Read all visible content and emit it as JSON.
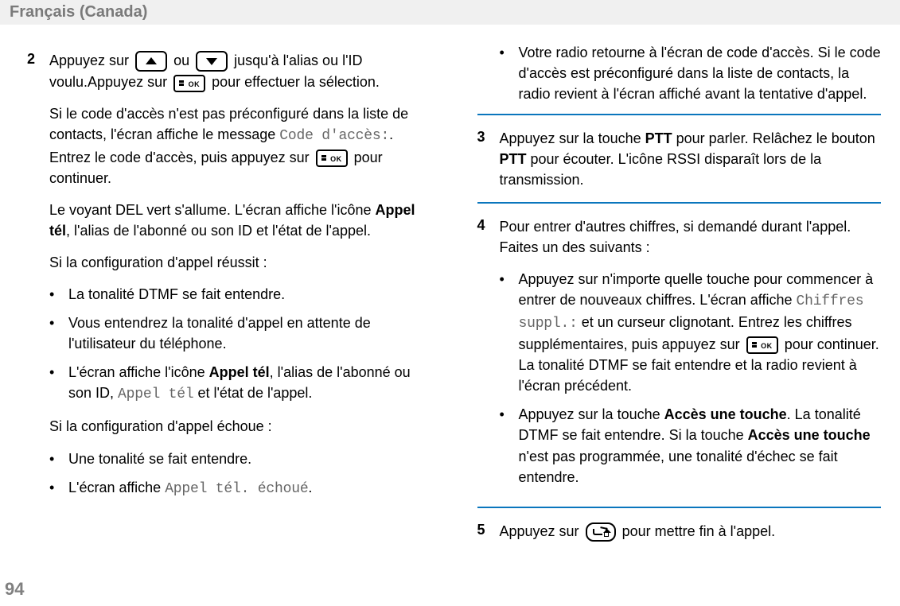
{
  "header": {
    "title": "Français (Canada)"
  },
  "pageNumber": "94",
  "left": {
    "step2": {
      "num": "2",
      "para1a": "Appuyez sur ",
      "para1b": " ou ",
      "para1c": " jusqu'à l'alias ou l'ID voulu.Appuyez sur ",
      "para1d": " pour effectuer la sélection.",
      "para2a": "Si le code d'accès n'est pas préconfiguré dans la liste de contacts, l'écran affiche le message ",
      "para2code": "Code d'accès:",
      "para2b": ". Entrez le code d'accès, puis appuyez sur ",
      "para2c": " pour continuer.",
      "para3a": "Le voyant DEL vert s'allume. L'écran affiche l'icône ",
      "para3bold": "Appel tél",
      "para3b": ", l'alias de l'abonné ou son ID et l'état de l'appel.",
      "para4": "Si la configuration d'appel réussit :",
      "success": [
        "La tonalité DTMF se fait entendre.",
        "Vous entendrez la tonalité d'appel en attente de l'utilisateur du téléphone."
      ],
      "success3a": "L'écran affiche l'icône ",
      "success3bold1": "Appel tél",
      "success3b": ", l'alias de l'abonné ou son ID, ",
      "success3code": "Appel tél",
      "success3c": " et l'état de l'appel.",
      "para5": "Si la configuration d'appel échoue :",
      "fail1": "Une tonalité se fait entendre.",
      "fail2a": "L'écran affiche ",
      "fail2code": "Appel tél. échoué",
      "fail2b": "."
    }
  },
  "right": {
    "contBullet": "Votre radio retourne à l'écran de code d'accès. Si le code d'accès est préconfiguré dans la liste de contacts, la radio revient à l'écran affiché avant la tentative d'appel.",
    "step3": {
      "num": "3",
      "a": "Appuyez sur la touche ",
      "ptt1": "PTT",
      "b": " pour parler. Relâchez le bouton ",
      "ptt2": "PTT",
      "c": " pour écouter. L'icône RSSI disparaît lors de la transmission."
    },
    "step4": {
      "num": "4",
      "intro": "Pour entrer d'autres chiffres, si demandé durant l'appel. Faites un des suivants :",
      "b1a": "Appuyez sur n'importe quelle touche pour commencer à entrer de nouveaux chiffres. L'écran affiche ",
      "b1code": "Chiffres suppl.:",
      "b1b": " et un curseur clignotant. Entrez les chiffres supplémentaires, puis appuyez sur ",
      "b1c": " pour continuer. La tonalité DTMF se fait entendre et la radio revient à l'écran précédent.",
      "b2a": "Appuyez sur la touche ",
      "b2bold1": "Accès une touche",
      "b2b": ". La tonalité DTMF se fait entendre. Si la touche ",
      "b2bold2": "Accès une touche",
      "b2c": " n'est pas programmée, une tonalité d'échec se fait entendre."
    },
    "step5": {
      "num": "5",
      "a": "Appuyez sur ",
      "b": " pour mettre fin à l'appel."
    }
  }
}
